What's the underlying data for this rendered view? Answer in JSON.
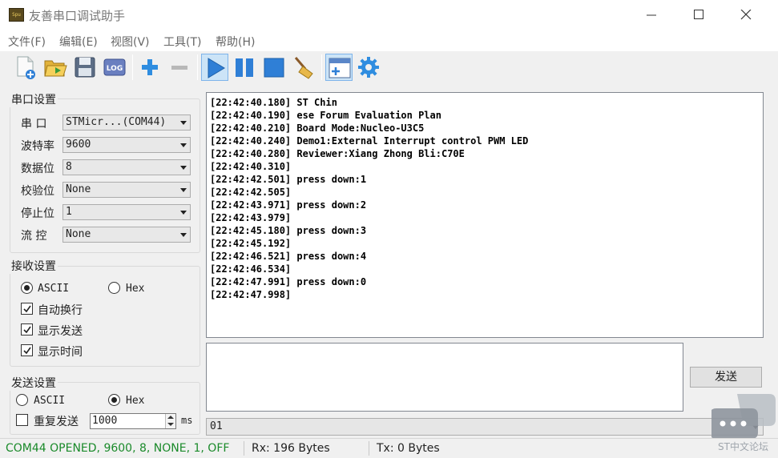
{
  "window": {
    "title": "友善串口调试助手",
    "app_icon_text": "Spu"
  },
  "menu": [
    "文件(F)",
    "编辑(E)",
    "视图(V)",
    "工具(T)",
    "帮助(H)"
  ],
  "toolbar": {
    "log_label": "LOG"
  },
  "serial_settings": {
    "title": "串口设置",
    "fields": [
      {
        "label": "串   口",
        "value": "STMicr...(COM44)"
      },
      {
        "label": "波特率",
        "value": "9600"
      },
      {
        "label": "数据位",
        "value": "8"
      },
      {
        "label": "校验位",
        "value": "None"
      },
      {
        "label": "停止位",
        "value": "1"
      },
      {
        "label": "流   控",
        "value": "None"
      }
    ]
  },
  "receive_settings": {
    "title": "接收设置",
    "ascii": "ASCII",
    "hex": "Hex",
    "mode_selected": "ASCII",
    "auto_newline": "自动换行",
    "show_send": "显示发送",
    "show_time": "显示时间"
  },
  "send_settings": {
    "title": "发送设置",
    "ascii": "ASCII",
    "hex": "Hex",
    "mode_selected": "Hex",
    "repeat_label": "重复发送",
    "repeat_interval": "1000",
    "unit": "ms"
  },
  "receive_log": [
    "[22:42:40.180] ST Chin",
    "[22:42:40.190] ese Forum Evaluation Plan",
    "[22:42:40.210] Board Mode:Nucleo-U3C5",
    "[22:42:40.240] Demo1:External Interrupt control PWM LED",
    "[22:42:40.280] Reviewer:Xiang Zhong Bli:C70E",
    "[22:42:40.310]",
    "[22:42:42.501] press down:1",
    "[22:42:42.505]",
    "[22:42:43.971] press down:2",
    "[22:42:43.979]",
    "[22:42:45.180] press down:3",
    "[22:42:45.192]",
    "[22:42:46.521] press down:4",
    "[22:42:46.534]",
    "[22:42:47.991] press down:0",
    "[22:42:47.998]"
  ],
  "send": {
    "button_label": "发送",
    "history_value": "01"
  },
  "status": {
    "port": "COM44 OPENED, 9600, 8, NONE, 1, OFF",
    "port_color": "#1a8a2a",
    "rx": "Rx: 196 Bytes",
    "tx": "Tx: 0 Bytes"
  },
  "watermark": "ST中文论坛"
}
